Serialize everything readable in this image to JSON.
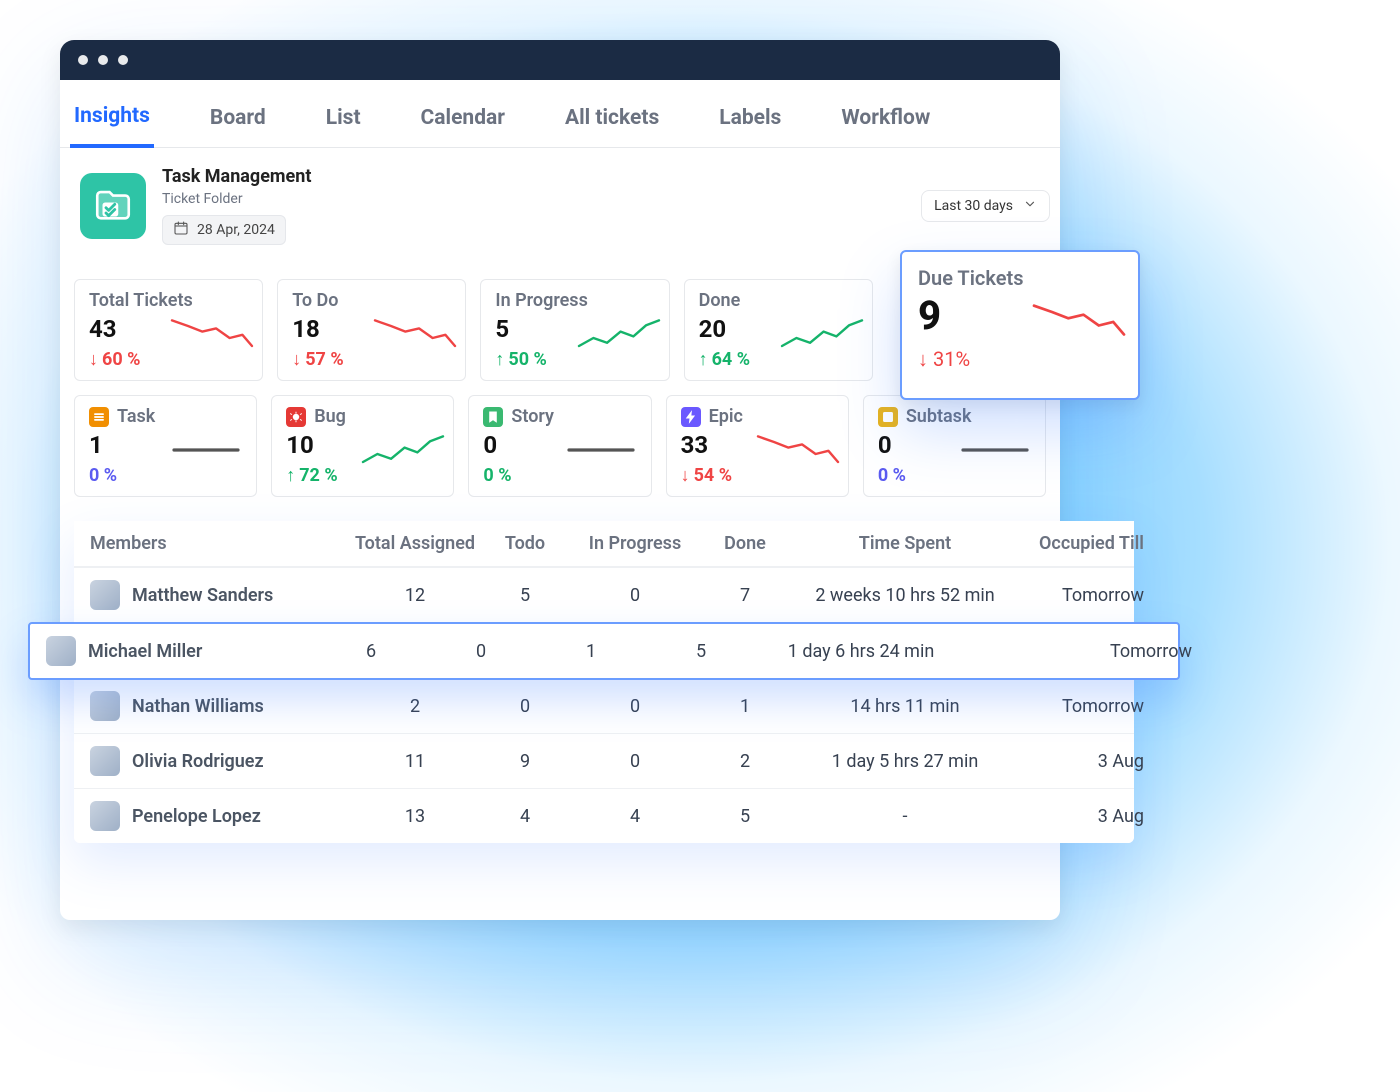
{
  "tabs": [
    "Insights",
    "Board",
    "List",
    "Calendar",
    "All tickets",
    "Labels",
    "Workflow"
  ],
  "active_tab": 0,
  "page": {
    "title": "Task Management",
    "subtitle": "Ticket Folder",
    "date": "28 Apr, 2024",
    "range": "Last 30 days"
  },
  "stat_cards": [
    {
      "label": "Total Tickets",
      "value": "43",
      "delta": "60 %",
      "dir": "down",
      "spark": "down-red"
    },
    {
      "label": "To Do",
      "value": "18",
      "delta": "57 %",
      "dir": "down",
      "spark": "down-red"
    },
    {
      "label": "In Progress",
      "value": "5",
      "delta": "50 %",
      "dir": "up",
      "spark": "up-green"
    },
    {
      "label": "Done",
      "value": "20",
      "delta": "64 %",
      "dir": "up",
      "spark": "up-green"
    }
  ],
  "due_card": {
    "label": "Due Tickets",
    "value": "9",
    "delta": "31%",
    "dir": "down",
    "spark": "down-red"
  },
  "type_cards": [
    {
      "icon": "task",
      "color": "#f18f01",
      "label": "Task",
      "value": "1",
      "delta": "0 %",
      "dir": "zero-alt",
      "spark": "flat"
    },
    {
      "icon": "bug",
      "color": "#e53935",
      "label": "Bug",
      "value": "10",
      "delta": "72 %",
      "dir": "up",
      "spark": "up-green"
    },
    {
      "icon": "story",
      "color": "#3ab971",
      "label": "Story",
      "value": "0",
      "delta": "0 %",
      "dir": "zero",
      "spark": "flat"
    },
    {
      "icon": "epic",
      "color": "#6a58ff",
      "label": "Epic",
      "value": "33",
      "delta": "54 %",
      "dir": "down",
      "spark": "down-red"
    },
    {
      "icon": "subtask",
      "color": "#e8b31c",
      "label": "Subtask",
      "value": "0",
      "delta": "0 %",
      "dir": "zero-alt",
      "spark": "flat"
    }
  ],
  "table": {
    "columns": [
      "Members",
      "Total Assigned",
      "Todo",
      "In Progress",
      "Done",
      "Time Spent",
      "Occupied Till"
    ],
    "rows": [
      {
        "name": "Matthew Sanders",
        "assigned": "12",
        "todo": "5",
        "inprog": "0",
        "done": "7",
        "time": "2 weeks 10 hrs 52 min",
        "till": "Tomorrow",
        "highlight": false
      },
      {
        "name": "Michael Miller",
        "assigned": "6",
        "todo": "0",
        "inprog": "1",
        "done": "5",
        "time": "1 day 6 hrs 24 min",
        "till": "Tomorrow",
        "highlight": true
      },
      {
        "name": "Nathan Williams",
        "assigned": "2",
        "todo": "0",
        "inprog": "0",
        "done": "1",
        "time": "14 hrs 11 min",
        "till": "Tomorrow",
        "highlight": false
      },
      {
        "name": "Olivia Rodriguez",
        "assigned": "11",
        "todo": "9",
        "inprog": "0",
        "done": "2",
        "time": "1 day 5 hrs 27 min",
        "till": "3 Aug",
        "highlight": false
      },
      {
        "name": "Penelope Lopez",
        "assigned": "13",
        "todo": "4",
        "inprog": "4",
        "done": "5",
        "time": "-",
        "till": "3 Aug",
        "highlight": false
      }
    ]
  },
  "chart_data": [
    {
      "type": "line",
      "title": "Total Tickets sparkline",
      "series": [
        {
          "name": "trend",
          "values": [
            10,
            9,
            8,
            6,
            7,
            6
          ]
        }
      ]
    },
    {
      "type": "line",
      "title": "To Do sparkline",
      "series": [
        {
          "name": "trend",
          "values": [
            10,
            9,
            7,
            8,
            6,
            5
          ]
        }
      ]
    },
    {
      "type": "line",
      "title": "In Progress sparkline",
      "series": [
        {
          "name": "trend",
          "values": [
            4,
            6,
            5,
            7,
            6,
            8
          ]
        }
      ]
    },
    {
      "type": "line",
      "title": "Done sparkline",
      "series": [
        {
          "name": "trend",
          "values": [
            5,
            6,
            7,
            6,
            8,
            9
          ]
        }
      ]
    },
    {
      "type": "line",
      "title": "Due Tickets sparkline",
      "series": [
        {
          "name": "trend",
          "values": [
            10,
            9,
            8,
            7,
            8,
            6
          ]
        }
      ]
    },
    {
      "type": "line",
      "title": "Task sparkline",
      "series": [
        {
          "name": "trend",
          "values": [
            5,
            5,
            5,
            5,
            5,
            5
          ]
        }
      ]
    },
    {
      "type": "line",
      "title": "Bug sparkline",
      "series": [
        {
          "name": "trend",
          "values": [
            3,
            5,
            4,
            6,
            7,
            8
          ]
        }
      ]
    },
    {
      "type": "line",
      "title": "Story sparkline",
      "series": [
        {
          "name": "trend",
          "values": [
            5,
            5,
            5,
            5,
            5,
            5
          ]
        }
      ]
    },
    {
      "type": "line",
      "title": "Epic sparkline",
      "series": [
        {
          "name": "trend",
          "values": [
            9,
            8,
            9,
            7,
            6,
            5
          ]
        }
      ]
    },
    {
      "type": "line",
      "title": "Subtask sparkline",
      "series": [
        {
          "name": "trend",
          "values": [
            5,
            5,
            5,
            5,
            5,
            5
          ]
        }
      ]
    }
  ]
}
